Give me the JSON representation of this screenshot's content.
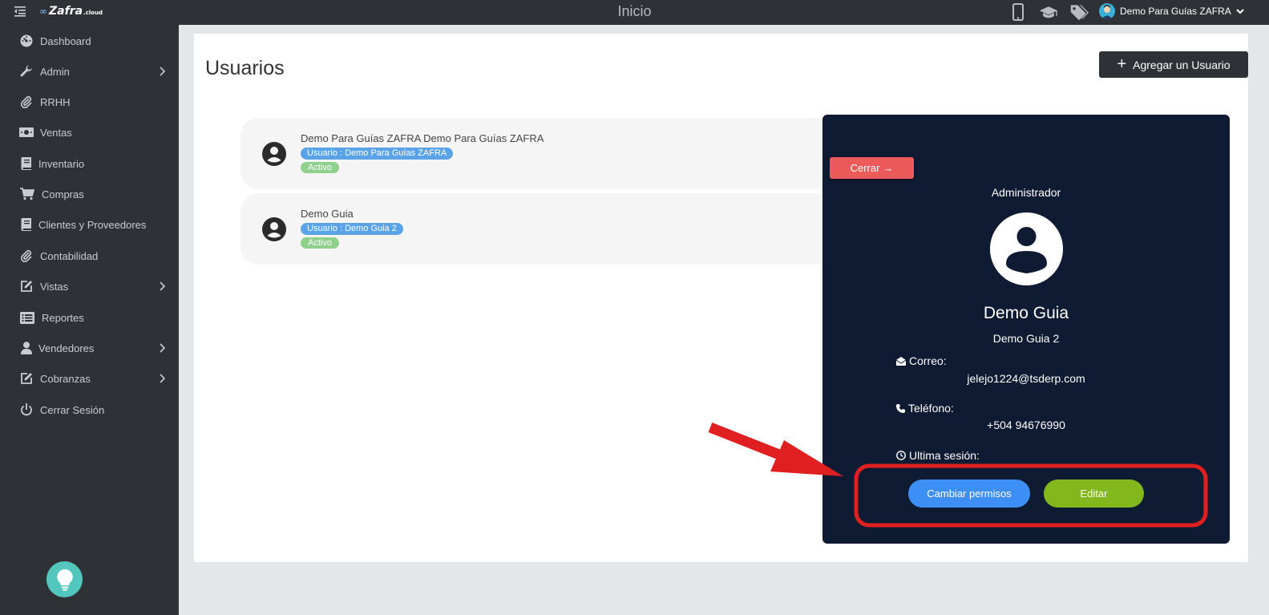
{
  "topbar": {
    "logo_text": "Zafra",
    "logo_suffix": ".cloud",
    "page_title": "Inicio",
    "user_name": "Demo Para Guías ZAFRA",
    "icons": [
      "mobile-icon",
      "graduation-cap-icon",
      "tags-icon"
    ]
  },
  "sidebar": {
    "items": [
      {
        "label": "Dashboard",
        "icon": "dashboard-icon",
        "chevron": false
      },
      {
        "label": "Admin",
        "icon": "wrench-icon",
        "chevron": true
      },
      {
        "label": "RRHH",
        "icon": "paperclip-icon",
        "chevron": false
      },
      {
        "label": "Ventas",
        "icon": "money-icon",
        "chevron": false
      },
      {
        "label": "Inventario",
        "icon": "book-icon",
        "chevron": false
      },
      {
        "label": "Compras",
        "icon": "cart-icon",
        "chevron": false
      },
      {
        "label": "Clientes y Proveedores",
        "icon": "book-icon",
        "chevron": false
      },
      {
        "label": "Contabilidad",
        "icon": "paperclip-icon",
        "chevron": false
      },
      {
        "label": "Vistas",
        "icon": "edit-icon",
        "chevron": true
      },
      {
        "label": "Reportes",
        "icon": "list-icon",
        "chevron": false
      },
      {
        "label": "Vendedores",
        "icon": "user-icon",
        "chevron": true
      },
      {
        "label": "Cobranzas",
        "icon": "edit-icon",
        "chevron": true
      },
      {
        "label": "Cerrar Sesión",
        "icon": "power-icon",
        "chevron": false
      }
    ]
  },
  "main": {
    "title": "Usuarios",
    "add_button_label": "Agregar un Usuario",
    "users": [
      {
        "name": "Demo Para Guías ZAFRA Demo Para Guías ZAFRA",
        "username_badge": "Usuario : Demo Para Guías ZAFRA",
        "status": "Activo"
      },
      {
        "name": "Demo Guia",
        "username_badge": "Usuario : Demo Guia 2",
        "status": "Activo"
      }
    ]
  },
  "detail": {
    "close_label": "Cerrar",
    "role": "Administrador",
    "name": "Demo Guia",
    "username": "Demo Guia 2",
    "email_label": "Correo:",
    "email": "jelejo1224@tsderp.com",
    "phone_label": "Teléfono:",
    "phone": "+504 94676990",
    "last_session_label": "Ultima sesión:",
    "permissions_button": "Cambiar permisos",
    "edit_button": "Editar"
  },
  "colors": {
    "sidebar_bg": "#2e3135",
    "panel_bg": "#0f1b33",
    "close_red": "#ec5a5a",
    "permissions_blue": "#3d8ff5",
    "edit_green": "#83b81c",
    "annotation_red": "#e02020"
  }
}
